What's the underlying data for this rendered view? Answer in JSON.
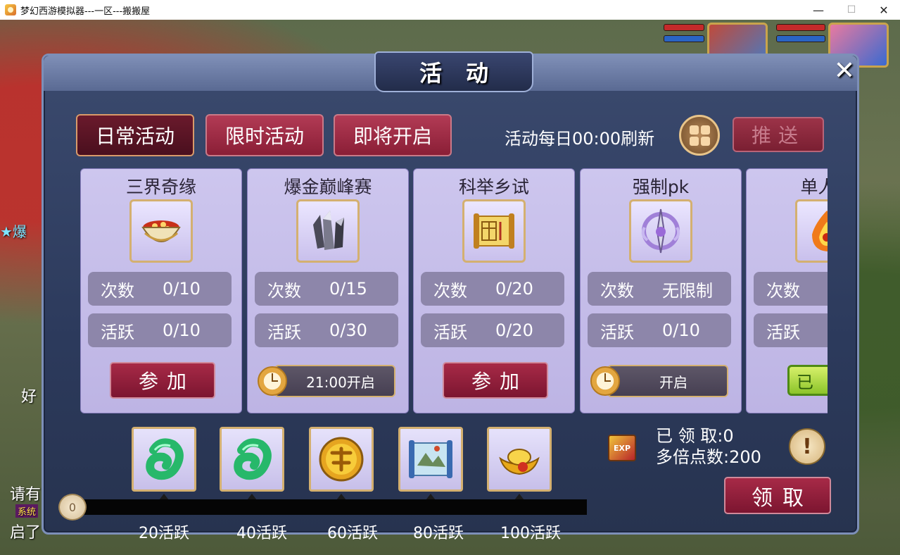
{
  "window": {
    "title": "梦幻西游模拟器---一区---搬搬屋",
    "minimize": "—",
    "maximize": "☐",
    "close": "✕"
  },
  "background": {
    "left_texts": [
      "★爆",
      "好",
      "请有",
      "启了",
      "系统"
    ]
  },
  "panel": {
    "title": "活动",
    "close_symbol": "✕",
    "tabs": [
      {
        "label": "日常活动",
        "active": true
      },
      {
        "label": "限时活动",
        "active": false
      },
      {
        "label": "即将开启",
        "active": false
      }
    ],
    "refresh_text": "活动每日00:00刷新",
    "push_button": "推送"
  },
  "activities": [
    {
      "name": "三界奇缘",
      "icon": "food-bowl-icon",
      "count_label": "次数",
      "count": "0/10",
      "active_label": "活跃",
      "active": "0/10",
      "action": {
        "type": "join",
        "label": "参加"
      }
    },
    {
      "name": "爆金巅峰赛",
      "icon": "crystal-icon",
      "count_label": "次数",
      "count": "0/15",
      "active_label": "活跃",
      "active": "0/30",
      "action": {
        "type": "timer",
        "label": "21:00开启"
      }
    },
    {
      "name": "科举乡试",
      "icon": "scroll-icon",
      "count_label": "次数",
      "count": "0/20",
      "active_label": "活跃",
      "active": "0/20",
      "action": {
        "type": "join",
        "label": "参加"
      }
    },
    {
      "name": "强制pk",
      "icon": "sword-emblem-icon",
      "count_label": "次数",
      "count": "无限制",
      "active_label": "活跃",
      "active": "0/10",
      "action": {
        "type": "timer",
        "label": "开启"
      }
    },
    {
      "name": "单人竞",
      "icon": "fire-orb-icon",
      "count_label": "次数",
      "count": "",
      "active_label": "活跃",
      "active": "",
      "action": {
        "type": "claimed",
        "label": "已"
      }
    }
  ],
  "rewards": [
    {
      "label": "20活跃",
      "icon": "jade-green-icon"
    },
    {
      "label": "40活跃",
      "icon": "jade-green-icon"
    },
    {
      "label": "60活跃",
      "icon": "gold-coin-icon"
    },
    {
      "label": "80活跃",
      "icon": "treasure-map-icon"
    },
    {
      "label": "100活跃",
      "icon": "gold-ingot-icon"
    }
  ],
  "progress": {
    "value": "0",
    "fraction": 0
  },
  "claim": {
    "exp_icon_text": "EXP",
    "claimed_text": "已 领 取:0",
    "multiplier_text": "多倍点数:200",
    "info_symbol": "!",
    "claim_button": "领取"
  }
}
